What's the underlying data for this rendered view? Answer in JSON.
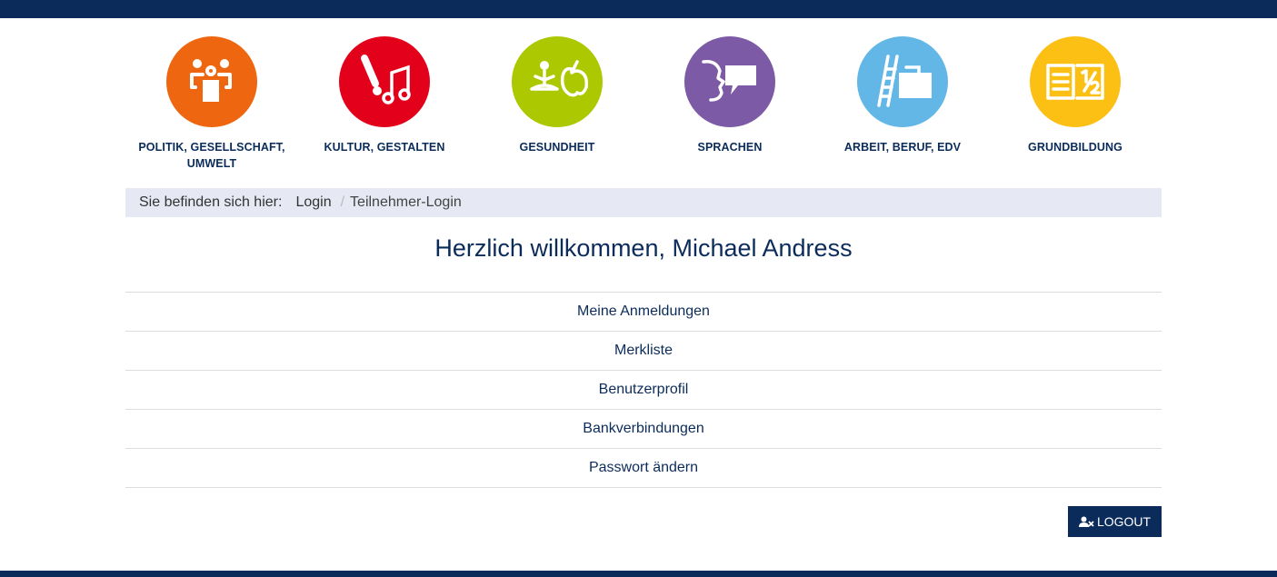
{
  "colors": {
    "brand": "#0b2c5a",
    "breadcrumb_bg": "#e6e9f4",
    "politik": "#ef6610",
    "kultur": "#e2001a",
    "gesundheit": "#abc800",
    "sprachen": "#7c5aa6",
    "arbeit": "#63b7e6",
    "grundbildung": "#fcbf14"
  },
  "categories": [
    {
      "label": "POLITIK, GESELLSCHAFT, UMWELT",
      "icon": "people-discussion-icon"
    },
    {
      "label": "KULTUR, GESTALTEN",
      "icon": "brush-music-icon"
    },
    {
      "label": "GESUNDHEIT",
      "icon": "yoga-apple-icon"
    },
    {
      "label": "SPRACHEN",
      "icon": "speech-bubble-icon"
    },
    {
      "label": "ARBEIT, BERUF, EDV",
      "icon": "ladder-briefcase-icon"
    },
    {
      "label": "GRUNDBILDUNG",
      "icon": "book-half-icon"
    }
  ],
  "breadcrumb": {
    "prefix": "Sie befinden sich hier:",
    "items": [
      "Login",
      "Teilnehmer-Login"
    ],
    "separator": "/"
  },
  "welcome": "Herzlich willkommen, Michael Andress",
  "menu": [
    "Meine Anmeldungen",
    "Merkliste",
    "Benutzerprofil",
    "Bankverbindungen",
    "Passwort ändern"
  ],
  "logout": {
    "label": "LOGOUT",
    "icon": "user-remove-icon"
  }
}
